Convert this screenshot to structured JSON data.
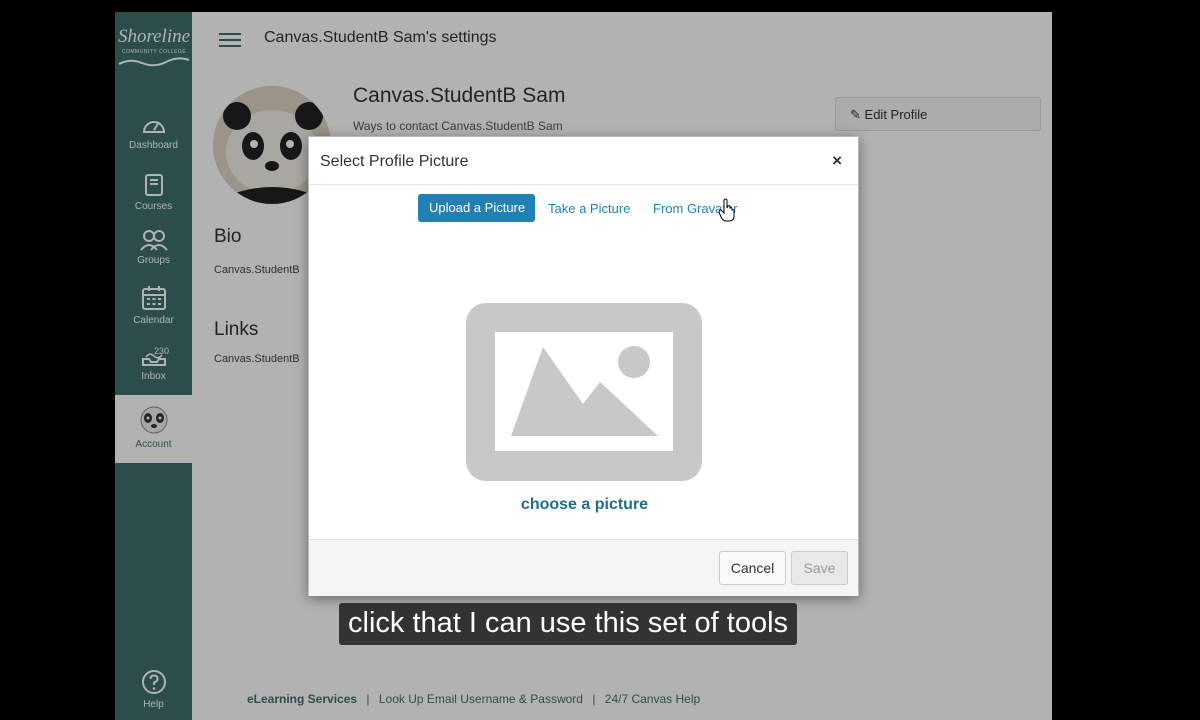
{
  "app": {
    "logo_text": "Shoreline",
    "logo_sub": "COMMUNITY COLLEGE",
    "page_title": "Canvas.StudentB Sam's settings"
  },
  "sidebar": {
    "items": [
      {
        "label": "Dashboard",
        "icon": "dashboard-icon"
      },
      {
        "label": "Courses",
        "icon": "courses-icon"
      },
      {
        "label": "Groups",
        "icon": "groups-icon"
      },
      {
        "label": "Calendar",
        "icon": "calendar-icon"
      },
      {
        "label": "Inbox",
        "icon": "inbox-icon",
        "badge": "230"
      },
      {
        "label": "Account",
        "icon": "account-avatar-icon"
      },
      {
        "label": "Help",
        "icon": "help-icon"
      }
    ]
  },
  "profile": {
    "name": "Canvas.StudentB Sam",
    "contact_subtitle": "Ways to contact Canvas.StudentB Sam",
    "edit_label": "Edit Profile",
    "bio_heading": "Bio",
    "bio_text": "Canvas.StudentB",
    "links_heading": "Links",
    "links_text": "Canvas.StudentB"
  },
  "footer": {
    "links": [
      "eLearning Services",
      "Look Up Email Username & Password",
      "24/7 Canvas Help"
    ]
  },
  "modal": {
    "title": "Select Profile Picture",
    "close": "×",
    "tabs": [
      {
        "label": "Upload a Picture",
        "active": true
      },
      {
        "label": "Take a Picture",
        "active": false
      },
      {
        "label": "From Gravatar",
        "active": false
      }
    ],
    "choose_label": "choose a picture",
    "cancel_label": "Cancel",
    "save_label": "Save"
  },
  "caption": "click that I can use this set of tools",
  "colors": {
    "sidebar": "#3e6f6d",
    "primary_blue": "#2180b4",
    "link_teal": "#1f6f8b"
  }
}
